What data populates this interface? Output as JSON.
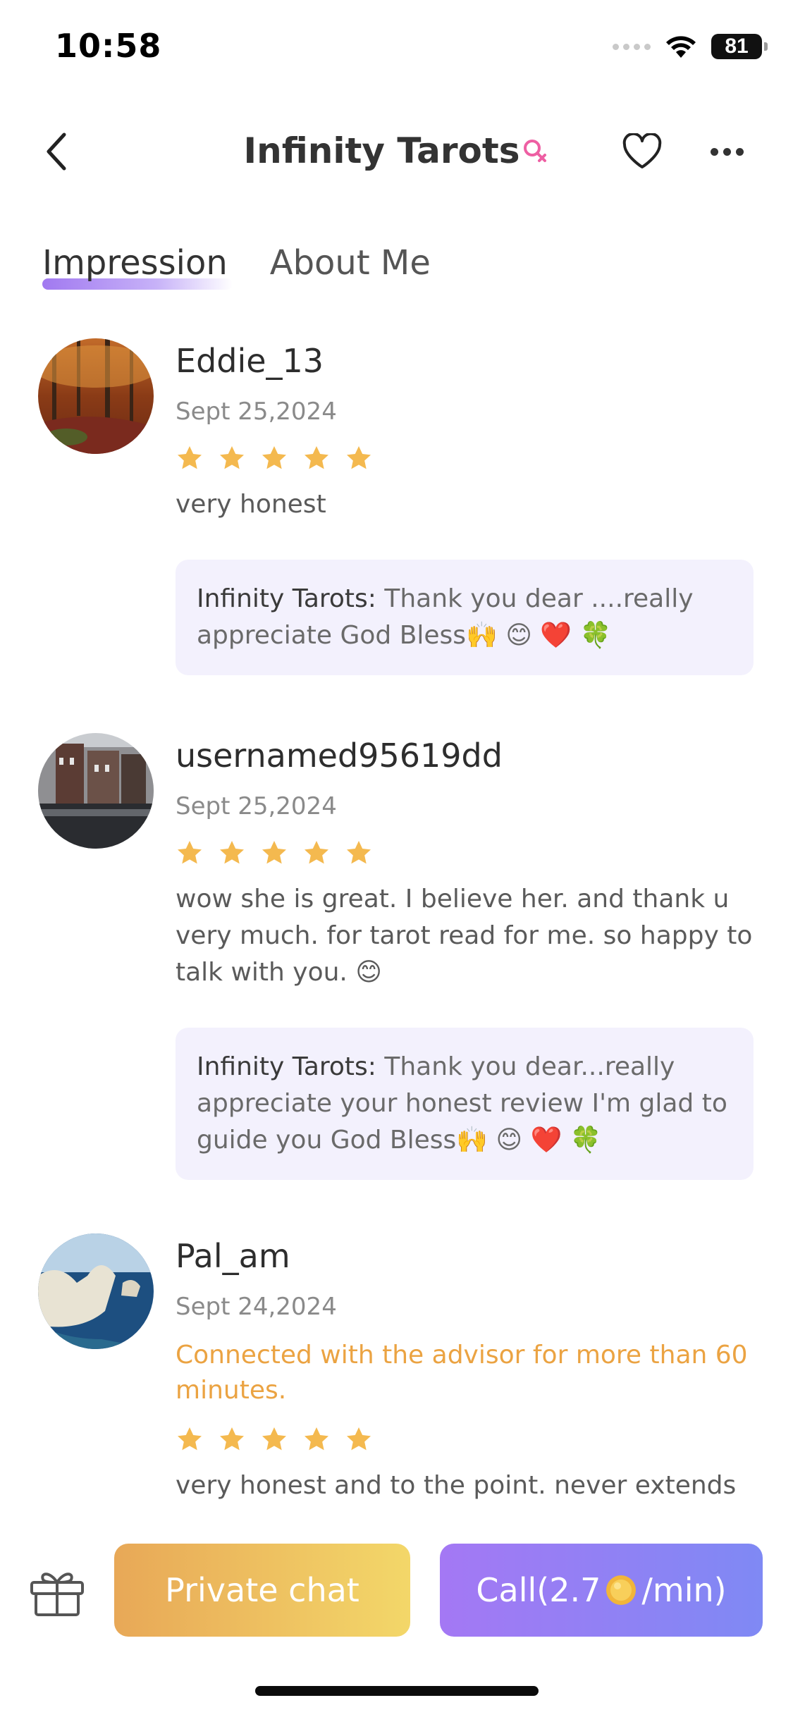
{
  "status_bar": {
    "time": "10:58",
    "battery": "81"
  },
  "header": {
    "title": "Infinity Tarots"
  },
  "tabs": [
    {
      "label": "Impression",
      "active": true
    },
    {
      "label": "About Me",
      "active": false
    }
  ],
  "reviews": [
    {
      "username": "Eddie_13",
      "date": "Sept 25,2024",
      "rating": 5,
      "text": "very honest",
      "reply": {
        "author": "Infinity Tarots:",
        "text": " Thank you dear ....really appreciate God Bless🙌 😊 ❤️ 🍀"
      }
    },
    {
      "username": "usernamed95619dd",
      "date": "Sept 25,2024",
      "rating": 5,
      "text": "wow she is great. I believe her. and thank u very much. for tarot read for me.  so happy to talk with you. 😊",
      "reply": {
        "author": "Infinity Tarots:",
        "text": " Thank you dear...really appreciate your honest review I'm glad to guide you God Bless🙌 😊 ❤️ 🍀"
      }
    },
    {
      "username": "Pal_am",
      "date": "Sept 24,2024",
      "connected": "Connected with the advisor for more than 60 minutes.",
      "rating": 5,
      "text": "very honest and to the point. never extends"
    }
  ],
  "bottom_bar": {
    "private_chat": "Private chat",
    "call_prefix": "Call(2.7",
    "call_suffix": "/min)"
  },
  "colors": {
    "star": "#f4b94f",
    "accent_purple": "#a179f0",
    "connected_text": "#eba342",
    "reply_bg": "#f3f1fd"
  },
  "icons": [
    "back-arrow-icon",
    "female-icon",
    "heart-icon",
    "more-dots-icon",
    "star-icon",
    "gift-icon",
    "coin-icon",
    "wifi-icon"
  ]
}
